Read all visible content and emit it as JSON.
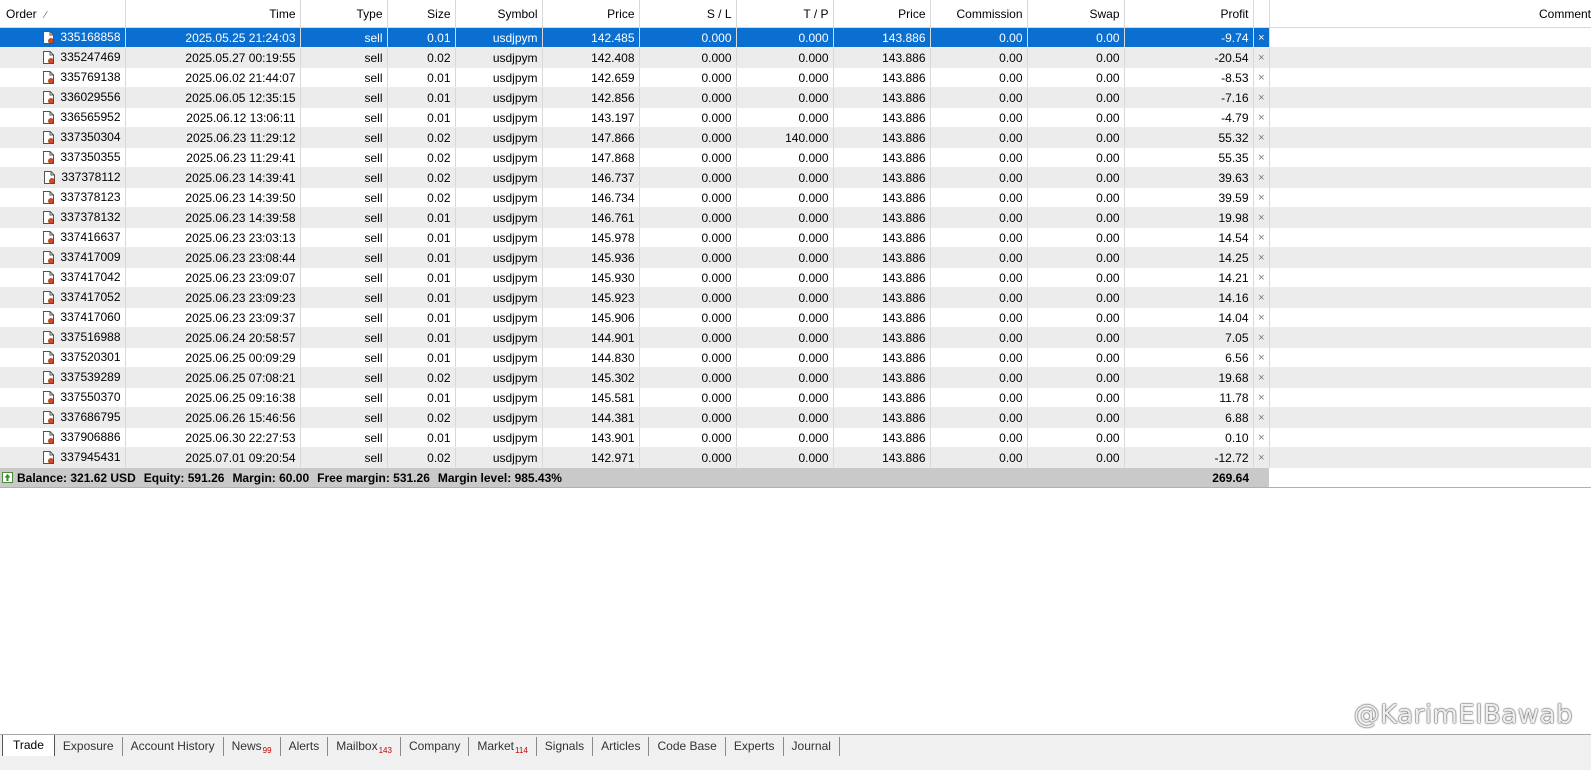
{
  "columns": {
    "order": "Order",
    "sort_mark": "⁄",
    "time": "Time",
    "type": "Type",
    "size": "Size",
    "symbol": "Symbol",
    "price": "Price",
    "sl": "S / L",
    "tp": "T / P",
    "price2": "Price",
    "commission": "Commission",
    "swap": "Swap",
    "profit": "Profit",
    "comment": "Comment"
  },
  "selected_row_index": 0,
  "close_glyph": "×",
  "rows": [
    {
      "order": "335168858",
      "time": "2025.05.25 21:24:03",
      "type": "sell",
      "size": "0.01",
      "symbol": "usdjpym",
      "price": "142.485",
      "sl": "0.000",
      "tp": "0.000",
      "price2": "143.886",
      "commission": "0.00",
      "swap": "0.00",
      "profit": "-9.74"
    },
    {
      "order": "335247469",
      "time": "2025.05.27 00:19:55",
      "type": "sell",
      "size": "0.02",
      "symbol": "usdjpym",
      "price": "142.408",
      "sl": "0.000",
      "tp": "0.000",
      "price2": "143.886",
      "commission": "0.00",
      "swap": "0.00",
      "profit": "-20.54"
    },
    {
      "order": "335769138",
      "time": "2025.06.02 21:44:07",
      "type": "sell",
      "size": "0.01",
      "symbol": "usdjpym",
      "price": "142.659",
      "sl": "0.000",
      "tp": "0.000",
      "price2": "143.886",
      "commission": "0.00",
      "swap": "0.00",
      "profit": "-8.53"
    },
    {
      "order": "336029556",
      "time": "2025.06.05 12:35:15",
      "type": "sell",
      "size": "0.01",
      "symbol": "usdjpym",
      "price": "142.856",
      "sl": "0.000",
      "tp": "0.000",
      "price2": "143.886",
      "commission": "0.00",
      "swap": "0.00",
      "profit": "-7.16"
    },
    {
      "order": "336565952",
      "time": "2025.06.12 13:06:11",
      "type": "sell",
      "size": "0.01",
      "symbol": "usdjpym",
      "price": "143.197",
      "sl": "0.000",
      "tp": "0.000",
      "price2": "143.886",
      "commission": "0.00",
      "swap": "0.00",
      "profit": "-4.79"
    },
    {
      "order": "337350304",
      "time": "2025.06.23 11:29:12",
      "type": "sell",
      "size": "0.02",
      "symbol": "usdjpym",
      "price": "147.866",
      "sl": "0.000",
      "tp": "140.000",
      "price2": "143.886",
      "commission": "0.00",
      "swap": "0.00",
      "profit": "55.32"
    },
    {
      "order": "337350355",
      "time": "2025.06.23 11:29:41",
      "type": "sell",
      "size": "0.02",
      "symbol": "usdjpym",
      "price": "147.868",
      "sl": "0.000",
      "tp": "0.000",
      "price2": "143.886",
      "commission": "0.00",
      "swap": "0.00",
      "profit": "55.35"
    },
    {
      "order": "337378112",
      "time": "2025.06.23 14:39:41",
      "type": "sell",
      "size": "0.02",
      "symbol": "usdjpym",
      "price": "146.737",
      "sl": "0.000",
      "tp": "0.000",
      "price2": "143.886",
      "commission": "0.00",
      "swap": "0.00",
      "profit": "39.63"
    },
    {
      "order": "337378123",
      "time": "2025.06.23 14:39:50",
      "type": "sell",
      "size": "0.02",
      "symbol": "usdjpym",
      "price": "146.734",
      "sl": "0.000",
      "tp": "0.000",
      "price2": "143.886",
      "commission": "0.00",
      "swap": "0.00",
      "profit": "39.59"
    },
    {
      "order": "337378132",
      "time": "2025.06.23 14:39:58",
      "type": "sell",
      "size": "0.01",
      "symbol": "usdjpym",
      "price": "146.761",
      "sl": "0.000",
      "tp": "0.000",
      "price2": "143.886",
      "commission": "0.00",
      "swap": "0.00",
      "profit": "19.98"
    },
    {
      "order": "337416637",
      "time": "2025.06.23 23:03:13",
      "type": "sell",
      "size": "0.01",
      "symbol": "usdjpym",
      "price": "145.978",
      "sl": "0.000",
      "tp": "0.000",
      "price2": "143.886",
      "commission": "0.00",
      "swap": "0.00",
      "profit": "14.54"
    },
    {
      "order": "337417009",
      "time": "2025.06.23 23:08:44",
      "type": "sell",
      "size": "0.01",
      "symbol": "usdjpym",
      "price": "145.936",
      "sl": "0.000",
      "tp": "0.000",
      "price2": "143.886",
      "commission": "0.00",
      "swap": "0.00",
      "profit": "14.25"
    },
    {
      "order": "337417042",
      "time": "2025.06.23 23:09:07",
      "type": "sell",
      "size": "0.01",
      "symbol": "usdjpym",
      "price": "145.930",
      "sl": "0.000",
      "tp": "0.000",
      "price2": "143.886",
      "commission": "0.00",
      "swap": "0.00",
      "profit": "14.21"
    },
    {
      "order": "337417052",
      "time": "2025.06.23 23:09:23",
      "type": "sell",
      "size": "0.01",
      "symbol": "usdjpym",
      "price": "145.923",
      "sl": "0.000",
      "tp": "0.000",
      "price2": "143.886",
      "commission": "0.00",
      "swap": "0.00",
      "profit": "14.16"
    },
    {
      "order": "337417060",
      "time": "2025.06.23 23:09:37",
      "type": "sell",
      "size": "0.01",
      "symbol": "usdjpym",
      "price": "145.906",
      "sl": "0.000",
      "tp": "0.000",
      "price2": "143.886",
      "commission": "0.00",
      "swap": "0.00",
      "profit": "14.04"
    },
    {
      "order": "337516988",
      "time": "2025.06.24 20:58:57",
      "type": "sell",
      "size": "0.01",
      "symbol": "usdjpym",
      "price": "144.901",
      "sl": "0.000",
      "tp": "0.000",
      "price2": "143.886",
      "commission": "0.00",
      "swap": "0.00",
      "profit": "7.05"
    },
    {
      "order": "337520301",
      "time": "2025.06.25 00:09:29",
      "type": "sell",
      "size": "0.01",
      "symbol": "usdjpym",
      "price": "144.830",
      "sl": "0.000",
      "tp": "0.000",
      "price2": "143.886",
      "commission": "0.00",
      "swap": "0.00",
      "profit": "6.56"
    },
    {
      "order": "337539289",
      "time": "2025.06.25 07:08:21",
      "type": "sell",
      "size": "0.02",
      "symbol": "usdjpym",
      "price": "145.302",
      "sl": "0.000",
      "tp": "0.000",
      "price2": "143.886",
      "commission": "0.00",
      "swap": "0.00",
      "profit": "19.68"
    },
    {
      "order": "337550370",
      "time": "2025.06.25 09:16:38",
      "type": "sell",
      "size": "0.01",
      "symbol": "usdjpym",
      "price": "145.581",
      "sl": "0.000",
      "tp": "0.000",
      "price2": "143.886",
      "commission": "0.00",
      "swap": "0.00",
      "profit": "11.78"
    },
    {
      "order": "337686795",
      "time": "2025.06.26 15:46:56",
      "type": "sell",
      "size": "0.02",
      "symbol": "usdjpym",
      "price": "144.381",
      "sl": "0.000",
      "tp": "0.000",
      "price2": "143.886",
      "commission": "0.00",
      "swap": "0.00",
      "profit": "6.88"
    },
    {
      "order": "337906886",
      "time": "2025.06.30 22:27:53",
      "type": "sell",
      "size": "0.01",
      "symbol": "usdjpym",
      "price": "143.901",
      "sl": "0.000",
      "tp": "0.000",
      "price2": "143.886",
      "commission": "0.00",
      "swap": "0.00",
      "profit": "0.10"
    },
    {
      "order": "337945431",
      "time": "2025.07.01 09:20:54",
      "type": "sell",
      "size": "0.02",
      "symbol": "usdjpym",
      "price": "142.971",
      "sl": "0.000",
      "tp": "0.000",
      "price2": "143.886",
      "commission": "0.00",
      "swap": "0.00",
      "profit": "-12.72"
    }
  ],
  "summary": {
    "balance": "Balance: 321.62 USD",
    "equity": "Equity: 591.26",
    "margin": "Margin: 60.00",
    "free_margin": "Free margin: 531.26",
    "margin_level": "Margin level: 985.43%",
    "total_profit": "269.64"
  },
  "tabs": [
    {
      "label": "Trade",
      "badge": "",
      "active": true
    },
    {
      "label": "Exposure",
      "badge": "",
      "active": false
    },
    {
      "label": "Account History",
      "badge": "",
      "active": false
    },
    {
      "label": "News",
      "badge": "99",
      "active": false
    },
    {
      "label": "Alerts",
      "badge": "",
      "active": false
    },
    {
      "label": "Mailbox",
      "badge": "143",
      "active": false
    },
    {
      "label": "Company",
      "badge": "",
      "active": false
    },
    {
      "label": "Market",
      "badge": "114",
      "active": false
    },
    {
      "label": "Signals",
      "badge": "",
      "active": false
    },
    {
      "label": "Articles",
      "badge": "",
      "active": false
    },
    {
      "label": "Code Base",
      "badge": "",
      "active": false
    },
    {
      "label": "Experts",
      "badge": "",
      "active": false
    },
    {
      "label": "Journal",
      "badge": "",
      "active": false
    }
  ],
  "watermark": "@KarimElBawab",
  "colors": {
    "selection": "#0a6fd1",
    "row_alt": "#ececec",
    "summary_bg": "#c9c9c9",
    "badge": "#c00000",
    "sell_icon_accent": "#d84a1b"
  },
  "icons": {
    "row_icon": "sell-order-document-icon",
    "summary_icon": "balance-up-arrow-icon",
    "close_icon": "close-position-icon"
  }
}
